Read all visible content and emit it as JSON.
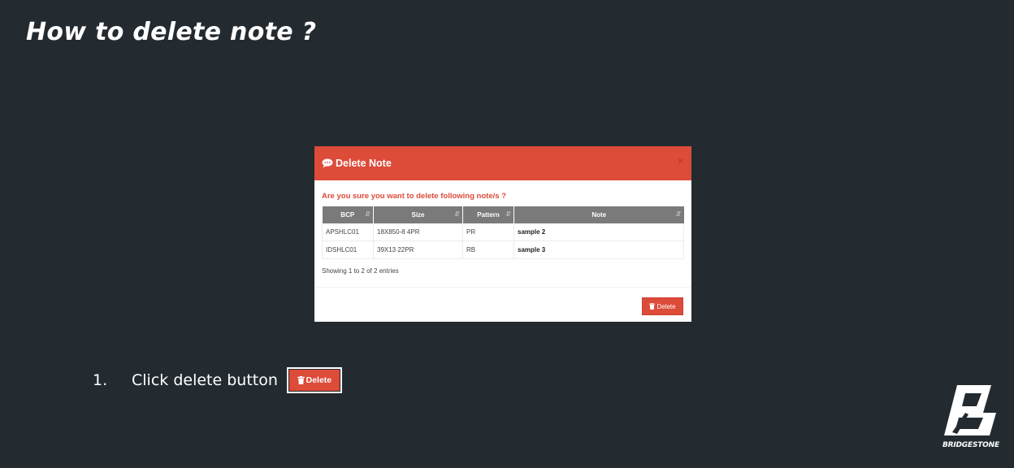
{
  "slide": {
    "title": "How to delete note ?"
  },
  "modal": {
    "title": "Delete Note",
    "close": "×",
    "confirm_text": "Are you sure you want to delete following note/s ?",
    "table": {
      "headers": [
        "BCP",
        "Size",
        "Pattern",
        "Note"
      ],
      "sort_glyph": "⇵",
      "rows": [
        [
          "APSHLC01",
          "18X850-8 4PR",
          "PR",
          "sample 2"
        ],
        [
          "IDSHLC01",
          "39X13 22PR",
          "RB",
          "sample 3"
        ]
      ]
    },
    "entries_info": "Showing 1 to 2 of 2 entries",
    "delete_label": "Delete"
  },
  "instruction": {
    "number": "1.",
    "text": "Click delete button",
    "button_label": "Delete"
  },
  "logo": {
    "wordmark": "BRIDGESTONE"
  },
  "colors": {
    "background": "#232b31",
    "accent": "#dd4b39",
    "table_header": "#7a7a7a"
  },
  "icons": {
    "header": "comment-icon",
    "button": "trash-icon",
    "sort": "sort-icon",
    "close": "close-icon"
  }
}
